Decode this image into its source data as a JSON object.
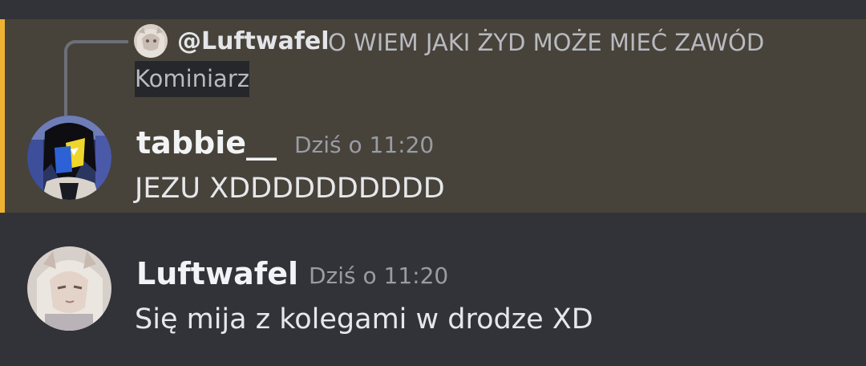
{
  "colors": {
    "background": "#323339",
    "highlight_background": "#47433b",
    "highlight_bar": "#f0b232"
  },
  "messages": [
    {
      "reply": {
        "author": "@Luftwafel",
        "text_line1": "O WIEM JAKI ŻYD MOŻE MIEĆ ZAWÓD",
        "text_line2": "Kominiarz"
      },
      "author": "tabbie__",
      "timestamp": "Dziś o 11:20",
      "content": "JEZU XDDDDDDDDDD",
      "highlighted": true,
      "avatar_icon": "tabbie-avatar-icon"
    },
    {
      "author": "Luftwafel",
      "timestamp": "Dziś o 11:20",
      "content": "Się mija z kolegami w drodze XD",
      "highlighted": false,
      "avatar_icon": "luftwafel-avatar-icon"
    }
  ]
}
